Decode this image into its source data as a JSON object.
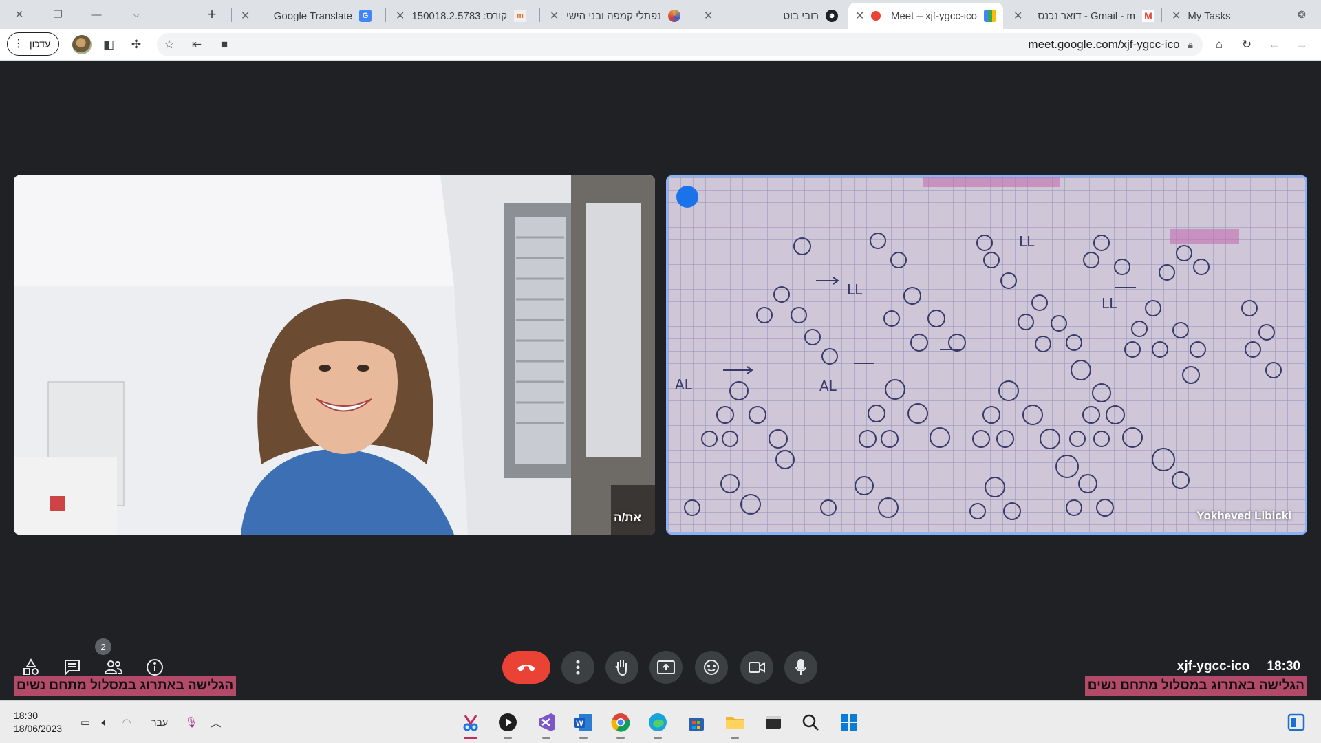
{
  "browser": {
    "tabs": [
      {
        "label": "My Tasks",
        "icon": "tasks-icon"
      },
      {
        "label": "דואר נכנס - Gmail - m",
        "icon": "gmail-icon"
      },
      {
        "label": "Meet – xjf-ygcc-ico",
        "icon": "google-meet-icon"
      },
      {
        "label": "רובי בוט",
        "icon": "bot-icon"
      },
      {
        "label": "נפתלי קמפה ובני הישי",
        "icon": "site-icon"
      },
      {
        "label": "קורס: 150018.2.5783",
        "icon": "moodle-icon"
      },
      {
        "label": "Google Translate",
        "icon": "google-translate-icon"
      }
    ],
    "new_tab_label": "+",
    "update_label": "עדכון",
    "url": "meet.google.com/xjf-ygcc-ico"
  },
  "meet": {
    "participants": [
      {
        "name": "את/ה",
        "is_self": true
      },
      {
        "name": "Yokheved Libicki",
        "is_self": false,
        "speaking": true
      }
    ],
    "participant_count": "2",
    "meeting_code": "xjf-ygcc-ico",
    "time": "18:30",
    "caption_left": "הגלישה באתרוג במסלול מתחם נשים",
    "caption_right": "הגלישה באתרוג במסלול מתחם נשים",
    "end_call_color": "#ea4335",
    "speaking_border_color": "#8ab4f8"
  },
  "taskbar": {
    "time": "18:30",
    "date": "18/06/2023",
    "language": "עבר",
    "apps": [
      "snipping-tool-icon",
      "media-player-icon",
      "visual-studio-icon",
      "word-icon",
      "chrome-icon",
      "edge-icon",
      "store-icon",
      "file-explorer-icon",
      "terminal-icon",
      "search-icon",
      "start-icon"
    ]
  }
}
